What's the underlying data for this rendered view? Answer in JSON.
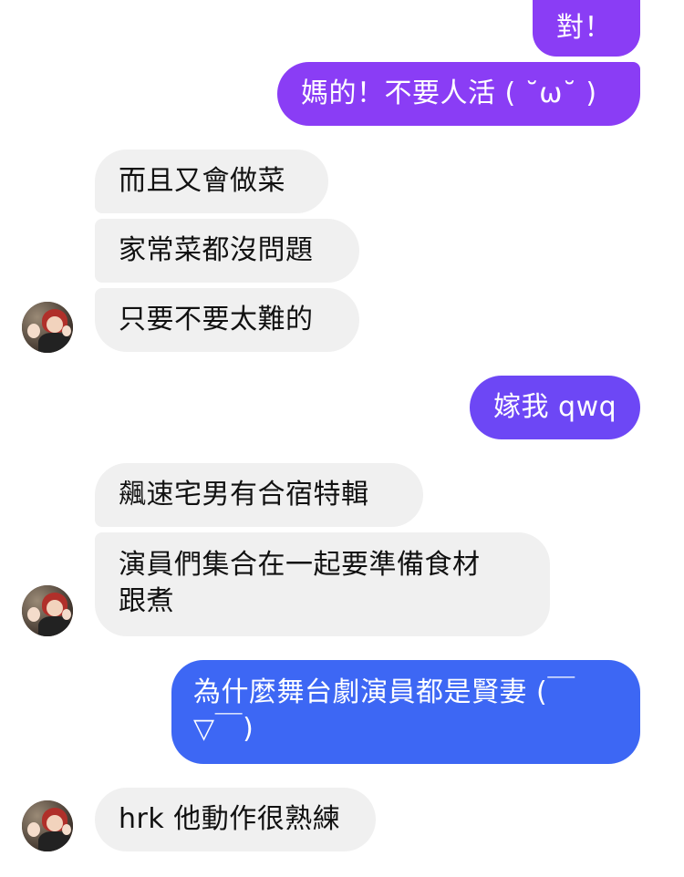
{
  "colors": {
    "incoming_bg": "#f0f0f0",
    "outgoing_purple": "#8a3df5",
    "outgoing_violet": "#6d47f5",
    "outgoing_blue": "#3d67f4"
  },
  "messages": [
    {
      "direction": "outgoing",
      "text": "對！"
    },
    {
      "direction": "outgoing",
      "text": "媽的！不要人活 ( ˘ω˘ )"
    },
    {
      "direction": "incoming",
      "text": "而且又會做菜"
    },
    {
      "direction": "incoming",
      "text": "家常菜都沒問題"
    },
    {
      "direction": "incoming",
      "text": "只要不要太難的"
    },
    {
      "direction": "outgoing",
      "text": "嫁我 qwq"
    },
    {
      "direction": "incoming",
      "text": "飆速宅男有合宿特輯"
    },
    {
      "direction": "incoming",
      "text_line1": "演員們集合在一起要準備食材",
      "text_line2": "跟煮"
    },
    {
      "direction": "outgoing",
      "text_line1": "為什麼舞台劇演員都是賢妻 (￣",
      "text_line2": "▽￣)"
    },
    {
      "direction": "incoming",
      "text": "hrk 他動作很熟練"
    }
  ],
  "avatars": [
    {
      "icon": "contact-avatar"
    },
    {
      "icon": "contact-avatar"
    },
    {
      "icon": "contact-avatar"
    }
  ]
}
